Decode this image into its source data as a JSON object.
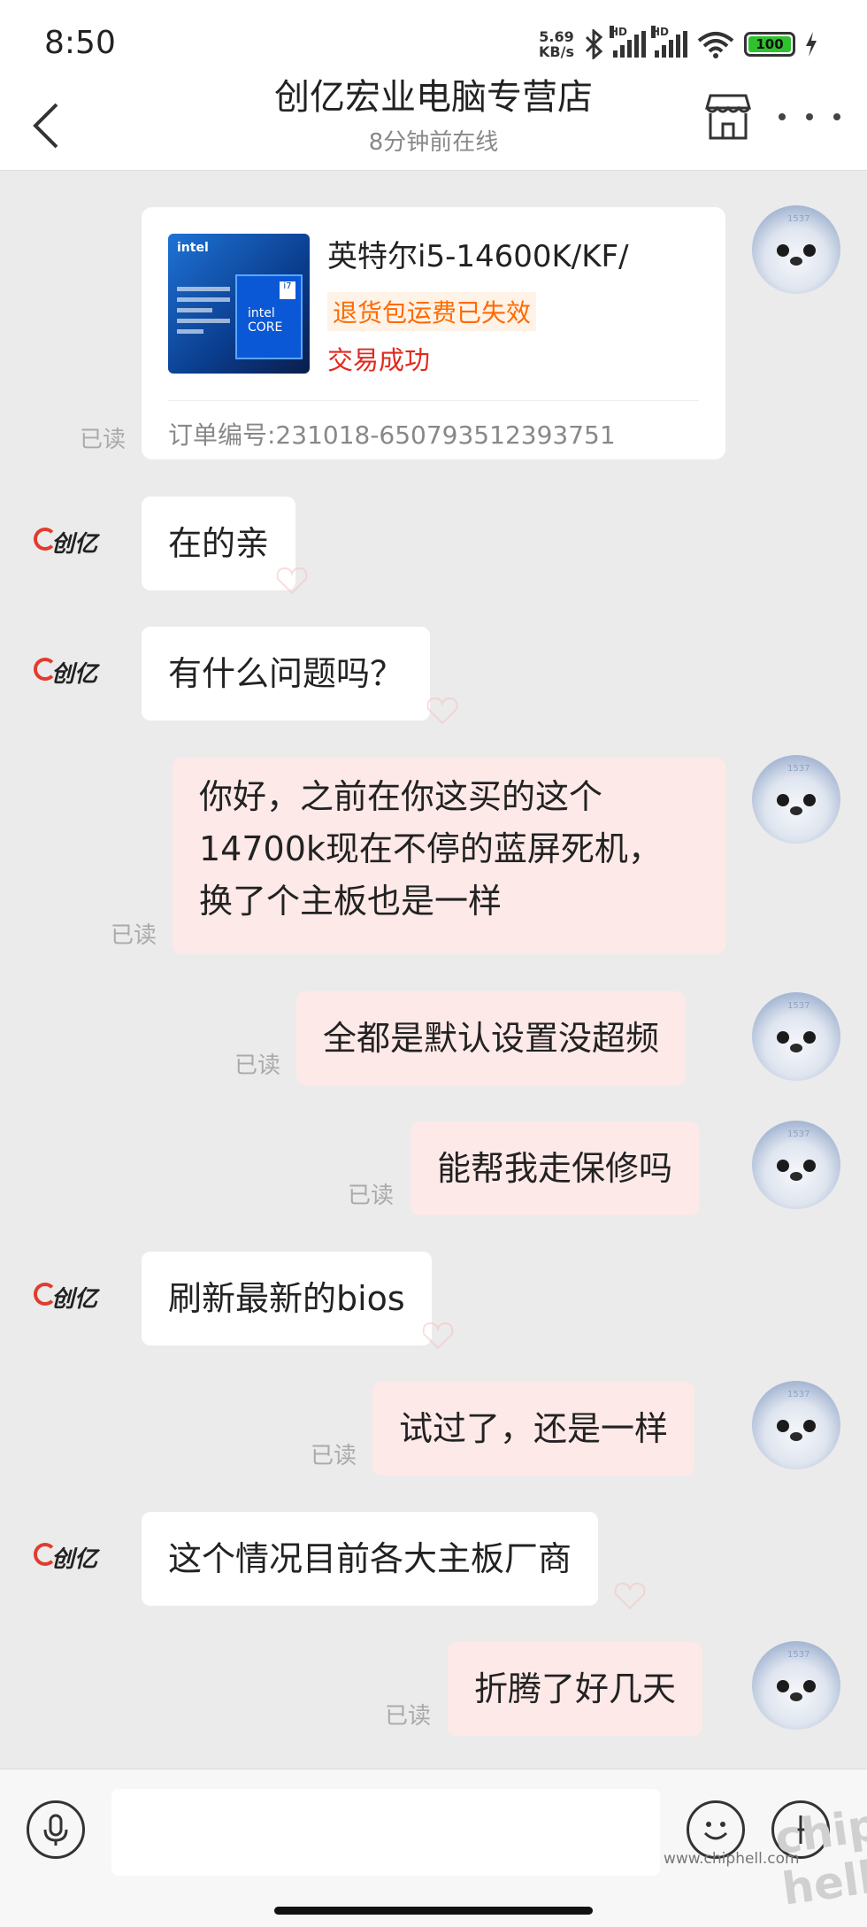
{
  "status_bar": {
    "time": "8:50",
    "net_speed_top": "5.69",
    "net_speed_unit": "KB/s",
    "battery": "100",
    "hd1": "HD",
    "hd2": "HD"
  },
  "header": {
    "title": "创亿宏业电脑专营店",
    "subtitle": "8分钟前在线",
    "back_icon": "chevron-left-icon",
    "shop_icon": "store-icon",
    "more_icon": "more-horizontal-icon"
  },
  "seller_logo_text": "创亿",
  "product_card": {
    "image_brand": "intel",
    "image_core_line1": "intel",
    "image_core_line2": "CORE",
    "image_badge": "i7",
    "name": "英特尔i5-14600K/KF/",
    "tag": "退货包运费已失效",
    "status": "交易成功",
    "order": "订单编号:231018-650793512393751",
    "read_label": "已读"
  },
  "messages": [
    {
      "from": "seller",
      "text": "在的亲"
    },
    {
      "from": "seller",
      "text": "有什么问题吗？"
    },
    {
      "from": "me",
      "lines": [
        "你好，之前在你这买的这个",
        "14700k现在不停的蓝屏死机，",
        "换了个主板也是一样"
      ],
      "read": "已读"
    },
    {
      "from": "me",
      "text": "全都是默认设置没超频",
      "read": "已读"
    },
    {
      "from": "me",
      "text": "能帮我走保修吗",
      "read": "已读"
    },
    {
      "from": "seller",
      "text": "刷新最新的bios"
    },
    {
      "from": "me",
      "text": "试过了，还是一样",
      "read": "已读"
    },
    {
      "from": "seller",
      "text": "这个情况目前各大主板厂商"
    },
    {
      "from": "me",
      "text": "折腾了好几天",
      "read": "已读"
    }
  ],
  "bottom_bar": {
    "mic_icon": "microphone-icon",
    "emoji_icon": "emoji-icon",
    "plus_icon": "plus-icon",
    "input_value": ""
  },
  "watermark": {
    "site": "www.chiphell.com",
    "big": "chip hell"
  },
  "colors": {
    "incoming_bubble": "#ffffff",
    "outgoing_bubble": "#fde9e8",
    "status_success": "#e02a1f",
    "tag_orange": "#ff6a00",
    "background": "#ebebeb"
  }
}
